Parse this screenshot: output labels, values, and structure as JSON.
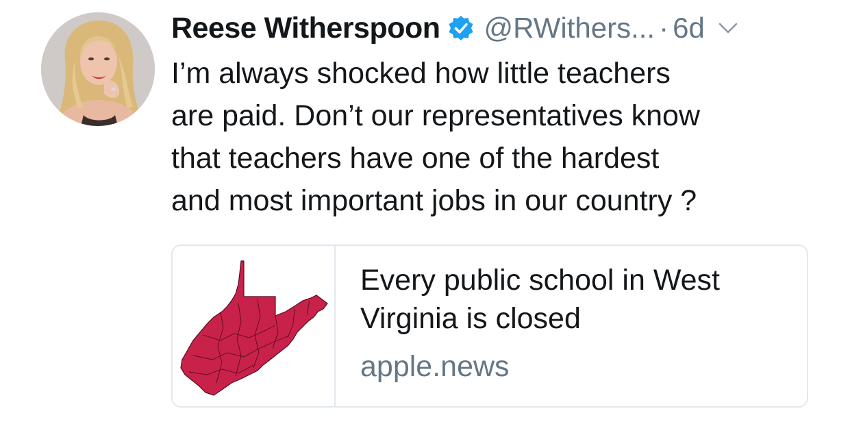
{
  "tweet": {
    "author": {
      "display_name": "Reese Witherspoon",
      "handle": "@RWithers...",
      "verified": true,
      "avatar_icon": "profile-photo"
    },
    "separator": "·",
    "timestamp": "6d",
    "menu_icon": "chevron-down-icon",
    "text": "I’m always shocked how little teachers\nare paid. Don’t our representatives know\nthat teachers have one of the hardest\nand most important jobs in our country ?"
  },
  "link_card": {
    "title": "Every public school in West Virginia is closed",
    "domain": "apple.news",
    "image_icon": "west-virginia-map",
    "map_fill_color": "#c8224a"
  },
  "colors": {
    "text_primary": "#14171a",
    "text_secondary": "#657786",
    "verified_blue": "#1da1f2",
    "border": "#e1e8ed"
  }
}
